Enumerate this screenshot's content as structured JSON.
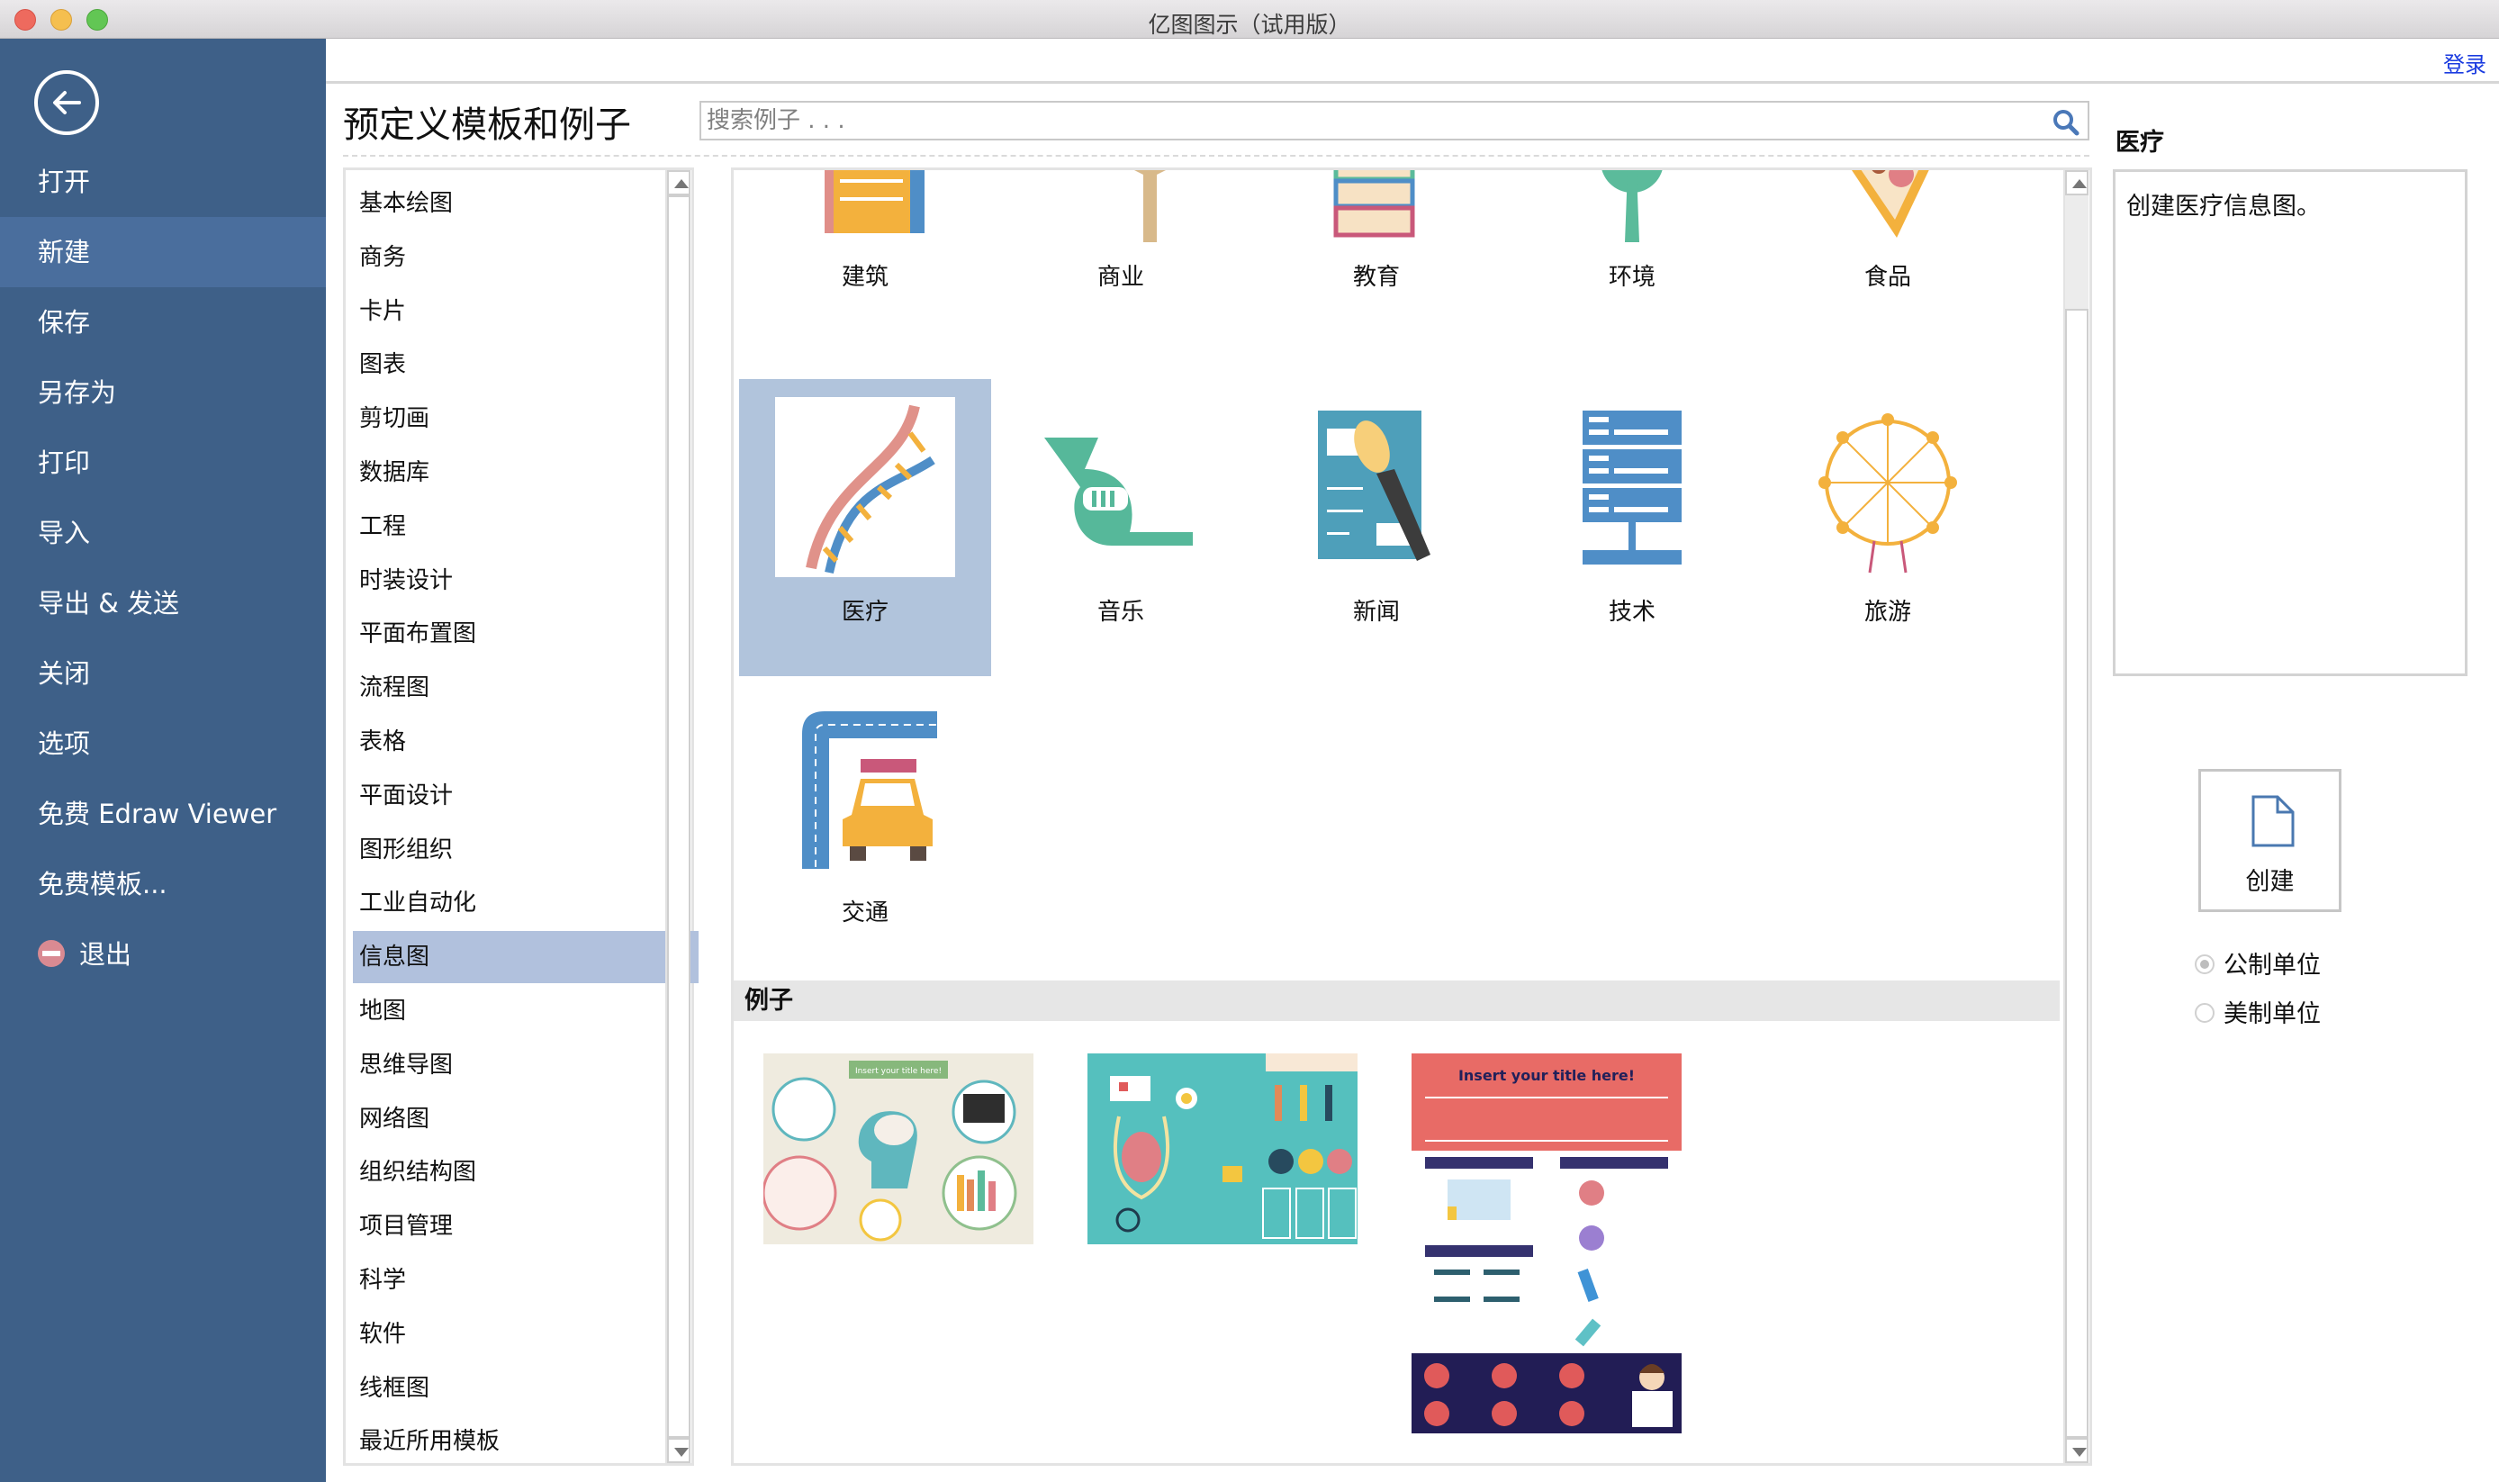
{
  "window": {
    "title": "亿图图示（试用版）"
  },
  "sidebar": {
    "back_label": "back",
    "items": [
      {
        "label": "打开",
        "active": false
      },
      {
        "label": "新建",
        "active": true
      },
      {
        "label": "保存",
        "active": false
      },
      {
        "label": "另存为",
        "active": false
      },
      {
        "label": "打印",
        "active": false
      },
      {
        "label": "导入",
        "active": false
      },
      {
        "label": "导出 & 发送",
        "active": false
      },
      {
        "label": "关闭",
        "active": false
      },
      {
        "label": "选项",
        "active": false
      },
      {
        "label": "免费 Edraw Viewer",
        "active": false
      },
      {
        "label": "免费模板...",
        "active": false
      },
      {
        "label": "退出",
        "active": false,
        "icon": "exit-icon"
      }
    ]
  },
  "header": {
    "login_label": "登录",
    "page_title": "预定义模板和例子",
    "search_placeholder": "搜索例子 . . ."
  },
  "categories": {
    "selected": "信息图",
    "items": [
      "基本绘图",
      "商务",
      "卡片",
      "图表",
      "剪切画",
      "数据库",
      "工程",
      "时装设计",
      "平面布置图",
      "流程图",
      "表格",
      "平面设计",
      "图形组织",
      "工业自动化",
      "信息图",
      "地图",
      "思维导图",
      "网络图",
      "组织结构图",
      "项目管理",
      "科学",
      "软件",
      "线框图",
      "最近所用模板"
    ]
  },
  "templates": {
    "selected": "医疗",
    "items": [
      {
        "label": "建筑",
        "icon": "buildings-icon"
      },
      {
        "label": "商业",
        "icon": "businessman-icon"
      },
      {
        "label": "教育",
        "icon": "books-icon"
      },
      {
        "label": "环境",
        "icon": "tree-icon"
      },
      {
        "label": "食品",
        "icon": "pizza-icon"
      },
      {
        "label": "医疗",
        "icon": "dna-icon"
      },
      {
        "label": "音乐",
        "icon": "french-horn-icon"
      },
      {
        "label": "新闻",
        "icon": "microphone-news-icon"
      },
      {
        "label": "技术",
        "icon": "server-network-icon"
      },
      {
        "label": "旅游",
        "icon": "ferris-wheel-icon"
      },
      {
        "label": "交通",
        "icon": "police-car-road-icon"
      }
    ]
  },
  "examples": {
    "header": "例子",
    "items": [
      {
        "name": "medical-brain-infographic",
        "title_text": "Insert your title here!"
      },
      {
        "name": "medical-teal-infographic",
        "title_text": ""
      },
      {
        "name": "medical-poster-infographic",
        "title_text": "Insert your title here!"
      }
    ]
  },
  "right_panel": {
    "title": "医疗",
    "description": "创建医疗信息图。",
    "create_label": "创建",
    "units": [
      {
        "label": "公制单位",
        "checked": true
      },
      {
        "label": "美制单位",
        "checked": false
      }
    ]
  },
  "colors": {
    "sidebar_bg": "#3e6088",
    "sidebar_active": "#4a6e9d",
    "selection": "#b1c1dd",
    "link": "#1a3be0"
  }
}
